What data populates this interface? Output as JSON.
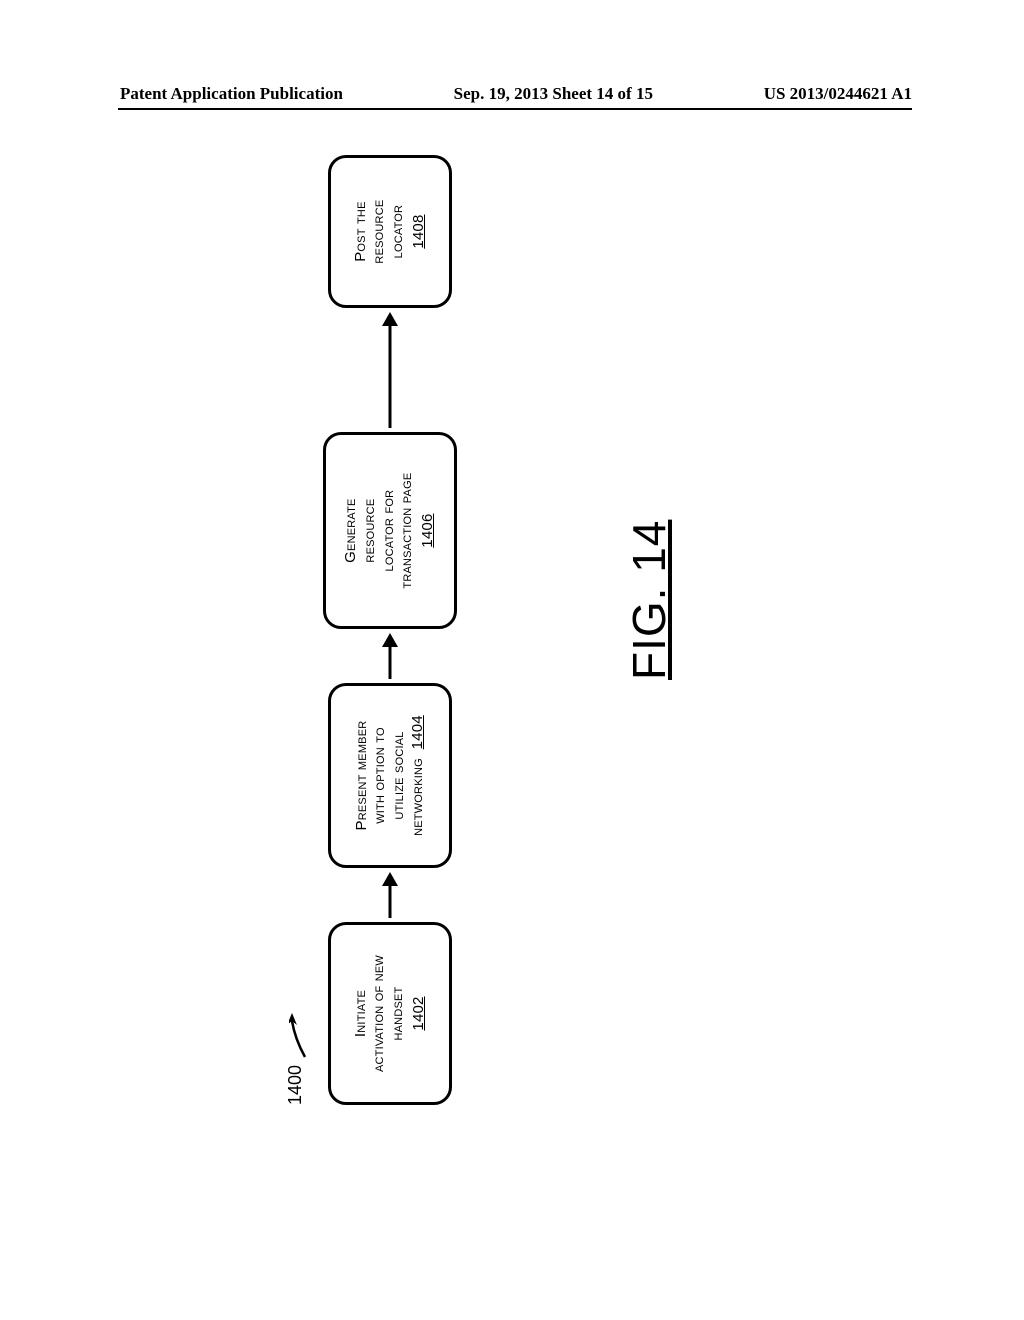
{
  "header": {
    "left": "Patent Application Publication",
    "center": "Sep. 19, 2013  Sheet 14 of 15",
    "right": "US 2013/0244621 A1"
  },
  "diagram": {
    "ref_number": "1400",
    "steps": [
      {
        "lines": [
          "Initiate",
          "activation of new",
          "handset"
        ],
        "num": "1402",
        "inline_num_with_last_line": false
      },
      {
        "lines": [
          "Present member",
          "with option to",
          "utilize social",
          "networking"
        ],
        "num": "1404",
        "inline_num_with_last_line": true
      },
      {
        "lines": [
          "Generate",
          "resource",
          "locator for",
          "transaction page"
        ],
        "num": "1406",
        "inline_num_with_last_line": false
      },
      {
        "lines": [
          "Post the",
          "resource",
          "locator"
        ],
        "num": "1408",
        "inline_num_with_last_line": false
      }
    ],
    "caption": "FIG. 14"
  }
}
